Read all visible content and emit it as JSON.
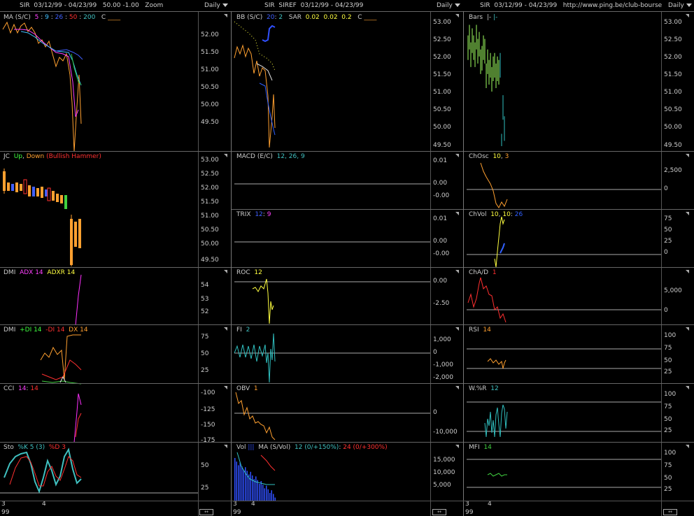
{
  "header": {
    "col1": {
      "symbol": "SIR",
      "range": "03/12/99 - 04/23/99",
      "vals": "50.00  -1.00",
      "zoom": "Zoom",
      "daily": "Daily"
    },
    "col2": {
      "symbol": "SIR",
      "ref": "SIREF",
      "range": "03/12/99 - 04/23/99",
      "daily": "Daily"
    },
    "col3": {
      "symbol": "SIR",
      "range": "03/12/99 - 04/23/99",
      "url": "http://www.ping.be/club-bourse",
      "daily": "Daily"
    }
  },
  "panels": {
    "ma": {
      "name": "MA (S/C)",
      "p": [
        "5",
        "9",
        "26",
        "50",
        "200"
      ],
      "c": "C"
    },
    "jc": {
      "name": "JC",
      "up": "Up",
      "down": "Down",
      "pattern": "(Bullish Hammer)"
    },
    "dmi1": {
      "name": "DMI",
      "adx": "ADX 14",
      "adxr": "ADXR 14"
    },
    "dmi2": {
      "name": "DMI",
      "pdi": "+DI 14",
      "mdi": "-DI 14",
      "dx": "DX 14"
    },
    "cci": {
      "name": "CCI",
      "p1": "14",
      "p2": "14"
    },
    "sto": {
      "name": "Sto",
      "k": "%K 5 (3)",
      "d": "%D 3"
    },
    "bb": {
      "name": "BB (S/C)",
      "p1": "20",
      "p2": "2",
      "sar": "SAR",
      "s1": "0.02",
      "s2": "0.02",
      "s3": "0.2",
      "c": "C"
    },
    "macd": {
      "name": "MACD (E/C)",
      "p": "12, 26, 9"
    },
    "trix": {
      "name": "TRIX",
      "p1": "12",
      "p2": "9"
    },
    "roc": {
      "name": "ROC",
      "p": "12"
    },
    "fi": {
      "name": "FI",
      "p": "2"
    },
    "obv": {
      "name": "OBV",
      "p": "1"
    },
    "vol": {
      "name": "Vol",
      "ma": "MA (S/Vol)",
      "a": "12 (0/+150%)",
      "b": "24 (0/+300%)"
    },
    "bars": {
      "name": "Bars"
    },
    "chosc": {
      "name": "ChOsc",
      "p1": "10",
      "p2": "3"
    },
    "chvol": {
      "name": "ChVol",
      "p1": "10",
      "p2": "10",
      "p3": "26"
    },
    "chad": {
      "name": "ChA/D",
      "p": "1"
    },
    "rsi": {
      "name": "RSI",
      "p": "14"
    },
    "wr": {
      "name": "W.%R",
      "p": "12"
    },
    "mfi": {
      "name": "MFI",
      "p": "14"
    }
  },
  "yticks": {
    "price": [
      "53.00",
      "52.50",
      "52.00",
      "51.50",
      "51.00",
      "50.50",
      "50.00",
      "49.50"
    ],
    "ma_price": [
      "52.00",
      "51.50",
      "51.00",
      "50.50",
      "50.00",
      "49.50"
    ],
    "dmi1": [
      "54",
      "53",
      "52"
    ],
    "dmi2": [
      "75",
      "50",
      "25"
    ],
    "cci": [
      "-100",
      "-125",
      "-150",
      "-175"
    ],
    "sto": [
      "50",
      "25"
    ],
    "macd": [
      "0.01",
      "0.00",
      "-0.00"
    ],
    "trix": [
      "0.01",
      "0.00",
      "-0.00"
    ],
    "roc": [
      "0.00",
      "-2.50"
    ],
    "fi": [
      "1,000",
      "0",
      "-1,000",
      "-2,000"
    ],
    "obv": [
      "0",
      "-10,000"
    ],
    "vol": [
      "15,000",
      "10,000",
      "5,000"
    ],
    "chosc": [
      "2,500",
      "0"
    ],
    "chvol": [
      "75",
      "50",
      "25",
      "0"
    ],
    "chad": [
      "5,000",
      "0"
    ],
    "hundred": [
      "100",
      "75",
      "50",
      "25"
    ]
  },
  "xaxis": {
    "m1": "3",
    "m2": "4",
    "year": "99",
    "scroll": "↔"
  },
  "colors": {
    "orange": "#ffa030",
    "blue": "#3060ff",
    "cyan": "#30c0c0",
    "green": "#40d040",
    "yellow": "#ffff40",
    "magenta": "#ff30ff",
    "red": "#ff3030",
    "purple": "#c040ff",
    "white": "#e0e0e0",
    "grey": "#888888",
    "lime": "#a0ff60"
  },
  "chart_data": {
    "type": "line",
    "title": "SIR 03/12/99 - 04/23/99",
    "close": [
      52.3,
      52.6,
      52.1,
      52.5,
      52.3,
      52.1,
      52.6,
      52.2,
      52.4,
      51.9,
      52.0,
      52.3,
      52.2,
      51.5,
      51.9,
      51.6,
      51.8,
      51.4,
      51.7,
      51.8,
      51.5,
      51.7,
      51.6,
      51.8,
      49.5,
      50.6,
      50.0
    ],
    "ylim": [
      49.5,
      53.0
    ]
  }
}
